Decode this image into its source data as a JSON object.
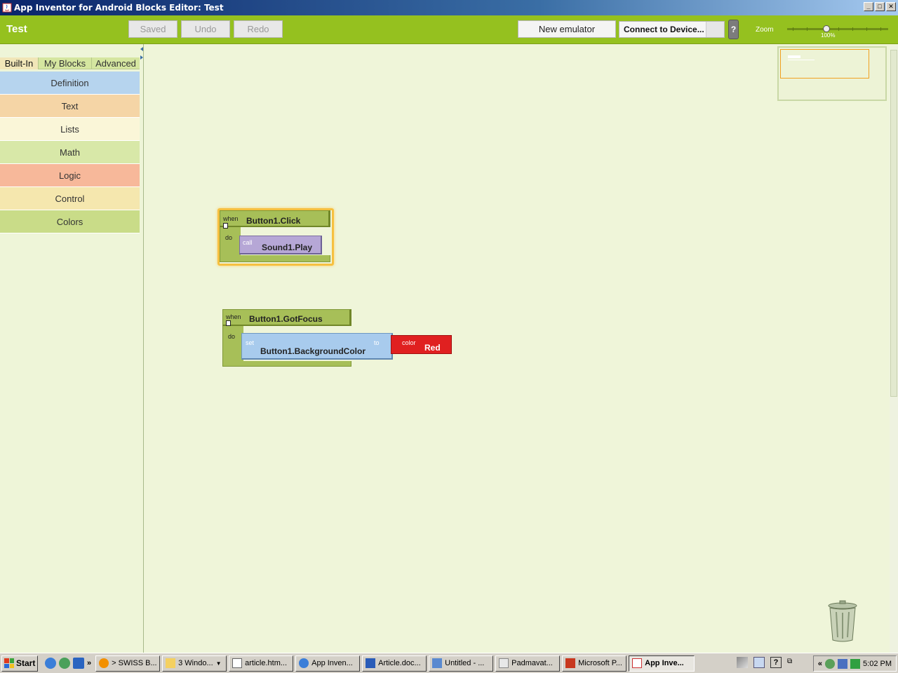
{
  "window": {
    "title": "App Inventor for Android Blocks Editor: Test"
  },
  "toolbar": {
    "project_name": "Test",
    "saved_label": "Saved",
    "undo_label": "Undo",
    "redo_label": "Redo",
    "new_emulator_label": "New emulator",
    "connect_label": "Connect to Device...",
    "help_label": "?",
    "zoom_label": "Zoom",
    "zoom_value": "100%"
  },
  "palette": {
    "tabs": [
      "Built-In",
      "My Blocks",
      "Advanced"
    ],
    "active_tab": "Built-In",
    "drawers": [
      {
        "label": "Definition",
        "color": "#b6d4ee"
      },
      {
        "label": "Text",
        "color": "#f5d5a6"
      },
      {
        "label": "Lists",
        "color": "#faf6d8"
      },
      {
        "label": "Math",
        "color": "#d8e8a8"
      },
      {
        "label": "Logic",
        "color": "#f7b89a"
      },
      {
        "label": "Control",
        "color": "#f5e7ae"
      },
      {
        "label": "Colors",
        "color": "#c9dc88"
      }
    ]
  },
  "blocks": {
    "click": {
      "when": "when",
      "name": "Button1.Click",
      "do": "do",
      "call": "call",
      "call_name": "Sound1.Play"
    },
    "focus": {
      "when": "when",
      "name": "Button1.GotFocus",
      "do": "do",
      "set": "set",
      "set_name": "Button1.BackgroundColor",
      "to": "to",
      "color_small": "color",
      "color_name": "Red"
    }
  },
  "taskbar": {
    "start_label": "Start",
    "tasks": [
      {
        "label": "> SWISS B...",
        "active": false
      },
      {
        "label": "3 Windo...",
        "active": false
      },
      {
        "label": "article.htm...",
        "active": false
      },
      {
        "label": "App Inven...",
        "active": false
      },
      {
        "label": "Article.doc...",
        "active": false
      },
      {
        "label": "Untitled - ...",
        "active": false
      },
      {
        "label": "Padmavat...",
        "active": false
      },
      {
        "label": "Microsoft P...",
        "active": false
      },
      {
        "label": "App Inve...",
        "active": true
      }
    ],
    "clock": "5:02 PM"
  },
  "colors": {
    "toolbar_green": "#95c11f",
    "event_block": "#a7bf58",
    "call_block": "#b6a7d6",
    "set_block": "#a8cbed",
    "color_block": "#e02020"
  }
}
